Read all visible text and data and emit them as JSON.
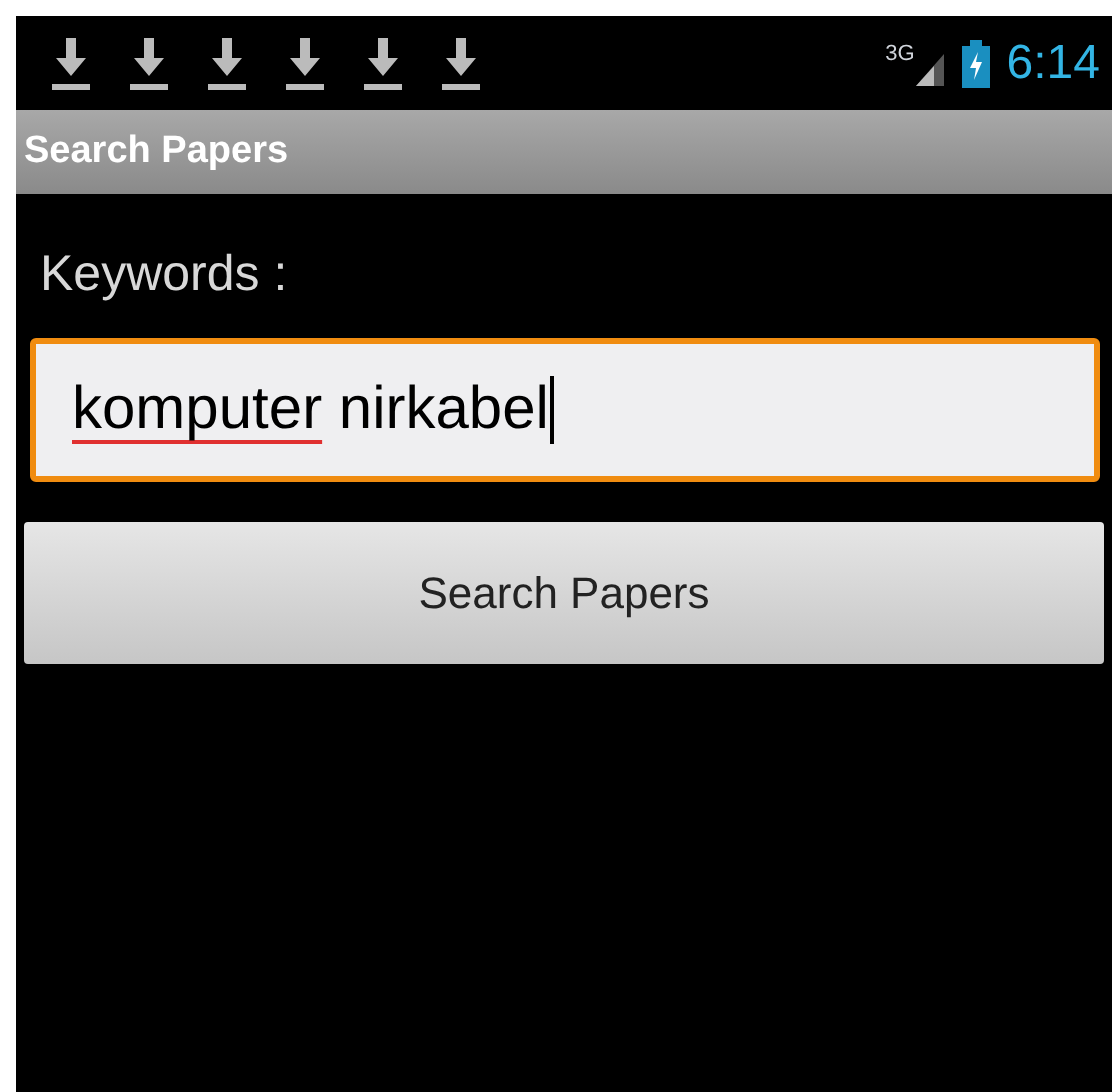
{
  "status_bar": {
    "notifications": [
      {
        "kind": "download"
      },
      {
        "kind": "download"
      },
      {
        "kind": "download"
      },
      {
        "kind": "download"
      },
      {
        "kind": "download"
      },
      {
        "kind": "download"
      }
    ],
    "network": "3G",
    "time": "6:14"
  },
  "title_bar": {
    "title": "Search Papers"
  },
  "form": {
    "label": "Keywords :",
    "field": {
      "focused": true,
      "words": [
        {
          "text": "komputer",
          "misspelled": true
        },
        {
          "text": "nirkabel",
          "misspelled": false
        }
      ]
    },
    "button": "Search Papers"
  }
}
